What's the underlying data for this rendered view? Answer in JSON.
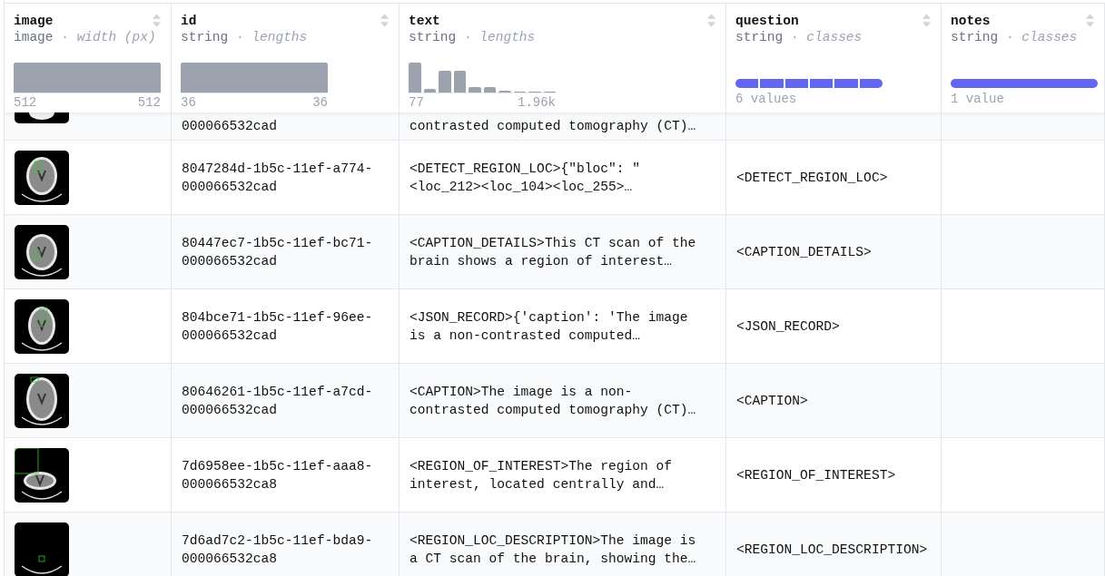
{
  "columns": [
    {
      "name": "image",
      "type": "image",
      "separator": "·",
      "stat": "width (px)",
      "kind": "histogram",
      "min": "512",
      "max": "512"
    },
    {
      "name": "id",
      "type": "string",
      "separator": "·",
      "stat": "lengths",
      "kind": "histogram",
      "min": "36",
      "max": "36"
    },
    {
      "name": "text",
      "type": "string",
      "separator": "·",
      "stat": "lengths",
      "kind": "histogram",
      "min": "77",
      "max": "1.96k"
    },
    {
      "name": "question",
      "type": "string",
      "separator": "·",
      "stat": "classes",
      "kind": "classes",
      "summary": "6 values"
    },
    {
      "name": "notes",
      "type": "string",
      "separator": "·",
      "stat": "classes",
      "kind": "classes",
      "summary": "1 value"
    }
  ],
  "rows": [
    {
      "kind": "partial",
      "id": "000066532cad",
      "text": "contrasted computed tomography (CT)…",
      "question": ""
    },
    {
      "kind": "full",
      "id": "8047284d-1b5c-11ef-a774-\n000066532cad",
      "text": "<DETECT_REGION_LOC>{\"bloc\": \"\n<loc_212><loc_104><loc_255>…",
      "question": "<DETECT_REGION_LOC>"
    },
    {
      "kind": "full",
      "id": "80447ec7-1b5c-11ef-bc71-\n000066532cad",
      "text": "<CAPTION_DETAILS>This CT scan of the\nbrain shows a region of interest…",
      "question": "<CAPTION_DETAILS>"
    },
    {
      "kind": "full",
      "id": "804bce71-1b5c-11ef-96ee-\n000066532cad",
      "text": "<JSON_RECORD>{'caption': 'The image\nis a non-contrasted computed…",
      "question": "<JSON_RECORD>"
    },
    {
      "kind": "full",
      "id": "80646261-1b5c-11ef-a7cd-\n000066532cad",
      "text": "<CAPTION>The image is a non-\ncontrasted computed tomography (CT)…",
      "question": "<CAPTION>"
    },
    {
      "kind": "full",
      "id": "7d6958ee-1b5c-11ef-aaa8-\n000066532ca8",
      "text": "<REGION_OF_INTEREST>The region of\ninterest, located centrally and…",
      "question": "<REGION_OF_INTEREST>"
    },
    {
      "kind": "full",
      "id": "7d6ad7c2-1b5c-11ef-bda9-\n000066532ca8",
      "text": "<REGION_LOC_DESCRIPTION>The image is\na CT scan of the brain, showing the…",
      "question": "<REGION_LOC_DESCRIPTION>"
    }
  ]
}
